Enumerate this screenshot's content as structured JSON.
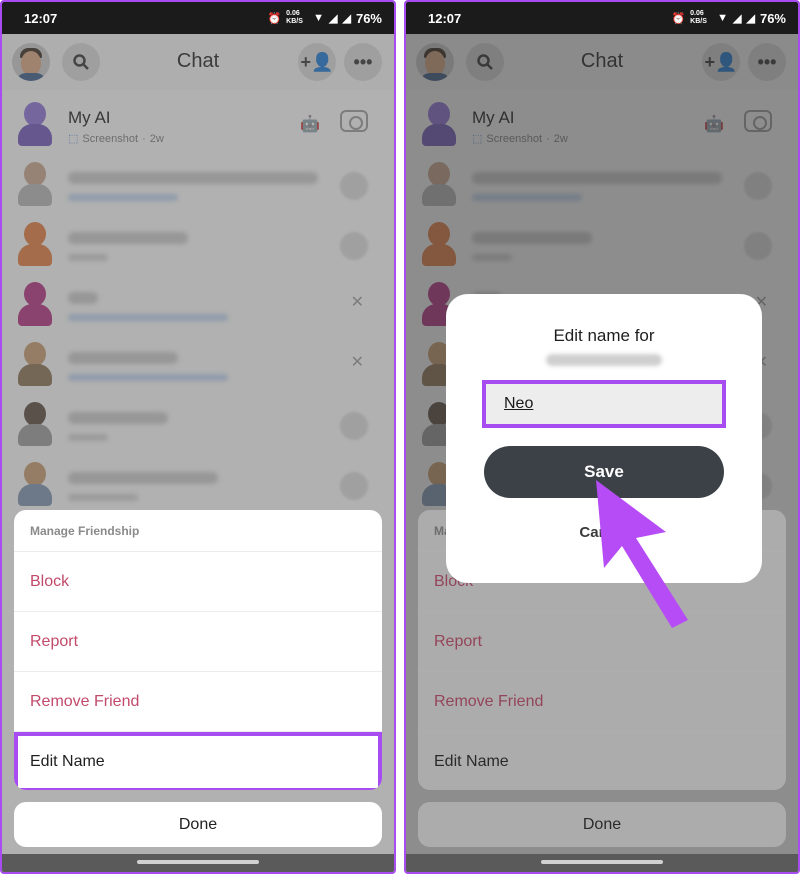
{
  "status": {
    "time": "12:07",
    "speed": "0.06 KB/S",
    "battery": "76%"
  },
  "header": {
    "title": "Chat"
  },
  "my_ai": {
    "name": "My AI",
    "status": "Screenshot",
    "age": "2w"
  },
  "sheet": {
    "title": "Manage Friendship",
    "items": [
      "Block",
      "Report",
      "Remove Friend",
      "Edit Name"
    ],
    "done": "Done"
  },
  "dialog": {
    "title": "Edit name for",
    "value": "Neo",
    "save": "Save",
    "cancel": "Cancel"
  },
  "colors": {
    "highlight": "#a64cf0",
    "danger": "#c24a6a",
    "save_button": "#3b4146"
  }
}
